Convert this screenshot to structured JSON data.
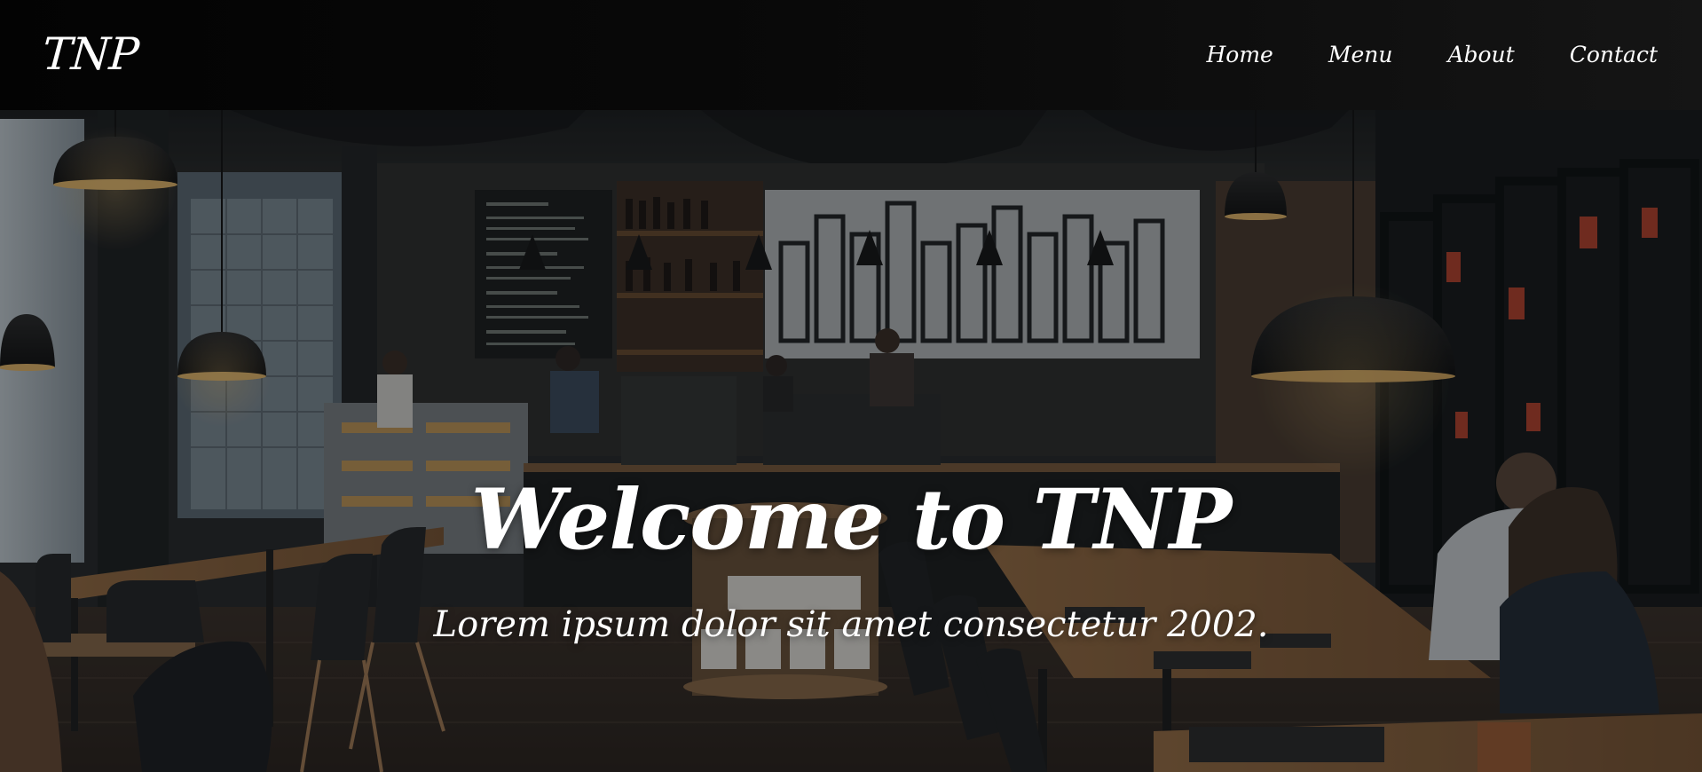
{
  "navbar": {
    "brand": "TNP",
    "links": [
      "Home",
      "Menu",
      "About",
      "Contact"
    ]
  },
  "hero": {
    "title": "Welcome to TNP",
    "subtitle": "Lorem ipsum dolor sit amet consectetur 2002.",
    "background_image": "cafe-interior"
  },
  "colors": {
    "navbar_bg": "#050505",
    "text": "#ffffff",
    "overlay": "#0a0c0e"
  }
}
